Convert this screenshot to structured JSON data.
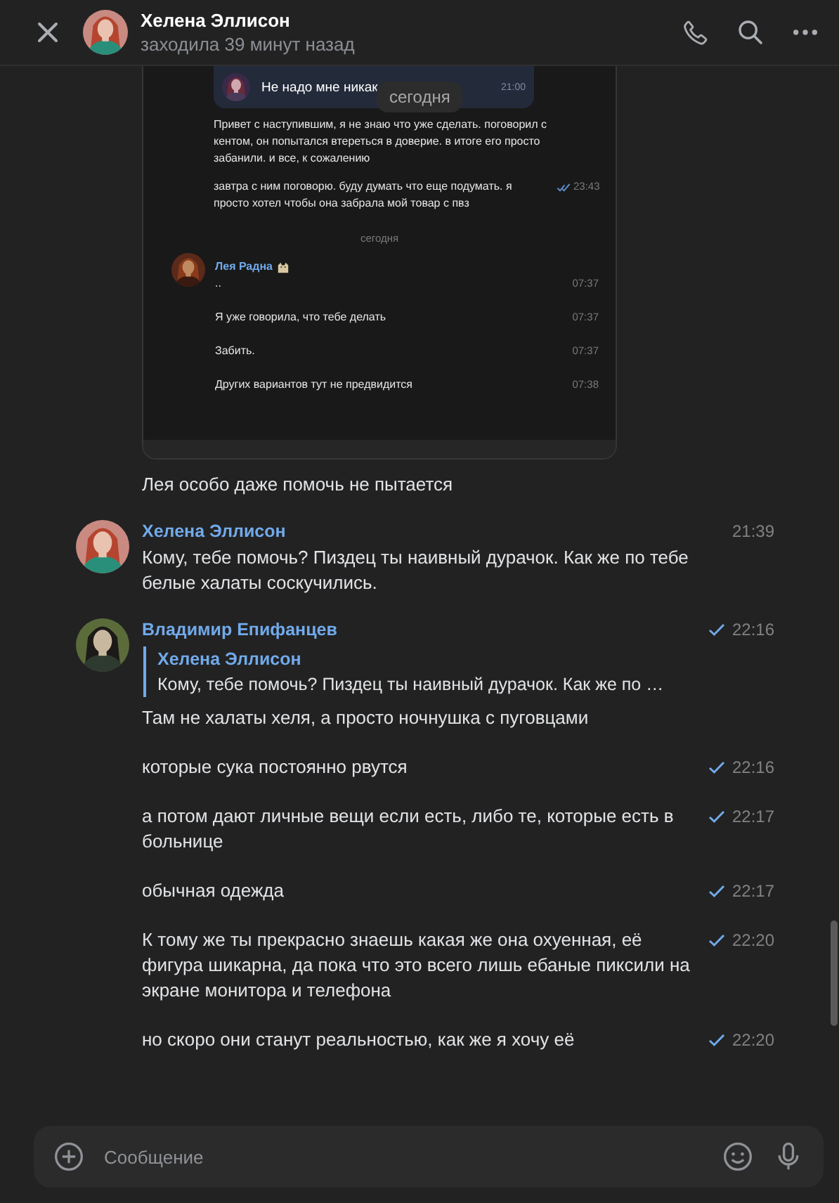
{
  "header": {
    "name": "Хелена Эллисон",
    "status": "заходила 39 минут назад"
  },
  "floating_date": "сегодня",
  "attachment": {
    "quote": {
      "text": "Не надо мне никак",
      "time": "21:00"
    },
    "own_messages": [
      {
        "text": "Привет с наступившим, я не знаю что уже сделать. поговорил с кентом, он попытался втереться в доверие. в итоге его просто забанили. и все, к сожалению"
      },
      {
        "text": "завтра с ним поговорю. буду думать что еще подумать. я просто хотел чтобы она забрала мой товар с пвз",
        "time": "23:43",
        "read": true
      }
    ],
    "date": "сегодня",
    "sender": "Лея Радна",
    "sender_messages": [
      {
        "text": "..",
        "time": "07:37"
      },
      {
        "text": "Я уже говорила, что тебе делать",
        "time": "07:37"
      },
      {
        "text": "Забить.",
        "time": "07:37"
      },
      {
        "text": "Других вариантов тут не предвидится",
        "time": "07:38"
      }
    ],
    "caption": "Лея особо даже помочь не пытается"
  },
  "groups": [
    {
      "sender": "Хелена Эллисон",
      "messages": [
        {
          "text": "Кому, тебе помочь? Пиздец ты наивный дурачок. Как же по тебе белые халаты соскучились.",
          "time": "21:39",
          "read": false
        }
      ]
    },
    {
      "sender": "Владимир Епифанцев",
      "messages": [
        {
          "reply": {
            "author": "Хелена Эллисон",
            "text": "Кому, тебе помочь? Пиздец ты наивный дурачок. Как же по …"
          },
          "text": "Там не халаты хеля, а просто ночнушка с пуговцами",
          "time": "22:16",
          "read": true
        },
        {
          "text": "которые сука постоянно рвутся",
          "time": "22:16",
          "read": true
        },
        {
          "text": "а потом дают личные вещи если есть, либо те, которые есть в больнице",
          "time": "22:17",
          "read": true
        },
        {
          "text": "обычная одежда",
          "time": "22:17",
          "read": true
        },
        {
          "text": "К тому же ты прекрасно знаешь какая же она охуенная, её фигура шикарна, да пока что это всего лишь ебаные пиксили на экране монитора и телефона",
          "time": "22:20",
          "read": true
        },
        {
          "text": "но скоро они станут реальностью, как же я хочу её",
          "time": "22:20",
          "read": true
        }
      ]
    }
  ],
  "composer": {
    "placeholder": "Сообщение"
  }
}
